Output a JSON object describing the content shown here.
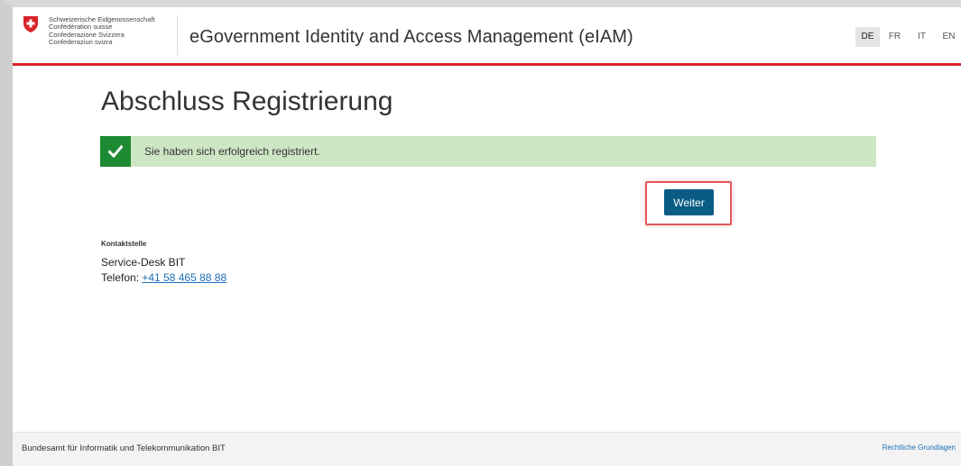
{
  "header": {
    "federal_lines": [
      "Schweizerische Eidgenossenschaft",
      "Confédération suisse",
      "Confederazione Svizzera",
      "Confederaziun svizra"
    ],
    "app_title": "eGovernment Identity and Access Management (eIAM)",
    "languages": [
      "DE",
      "FR",
      "IT",
      "EN"
    ],
    "active_language": "DE",
    "accent_color": "#d8232a"
  },
  "main": {
    "title": "Abschluss Registrierung",
    "alert": {
      "icon": "checkmark-icon",
      "message": "Sie haben sich erfolgreich registriert.",
      "background": "#cde6c3",
      "icon_background": "#1e8a33"
    },
    "continue_button": "Weiter",
    "button_color": "#0a5c85"
  },
  "contact": {
    "heading": "Kontaktstelle",
    "name": "Service-Desk BIT",
    "phone_label": "Telefon:",
    "phone": "+41 58 465 88 88"
  },
  "footer": {
    "org": "Bundesamt für Informatik und Telekommunikation BIT",
    "legal_link": "Rechtliche Grundlagen"
  }
}
